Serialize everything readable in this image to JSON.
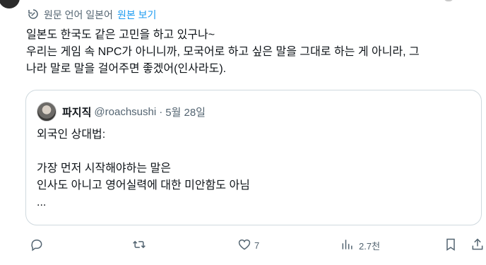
{
  "translation": {
    "note": "원문 언어 일본어",
    "show_original": "원본 보기"
  },
  "tweet": {
    "lines": [
      "일본도 한국도 같은 고민을 하고 있구나~",
      "우리는 게임 속 NPC가 아니니까, 모국어로 하고 싶은 말을 그대로 하는 게 아니라, 그",
      "나라 말로 말을 걸어주면 좋겠어(인사라도)."
    ]
  },
  "quote": {
    "name": "파지직",
    "handle": "@roachsushi",
    "separator": "·",
    "date": "5월 28일",
    "lines": [
      "외국인 상대법:",
      "",
      "가장 먼저 시작해야하는 말은",
      "인사도 아니고 영어실력에 대한 미안함도 아님",
      "..."
    ]
  },
  "actions": {
    "reply_count": "",
    "retweet_count": "",
    "like_count": "7",
    "views_count": "2.7천"
  },
  "icons": {
    "translate": "translate-icon",
    "reply": "reply-icon",
    "retweet": "retweet-icon",
    "like": "heart-icon",
    "views": "views-icon",
    "bookmark": "bookmark-icon",
    "share": "share-icon"
  },
  "colors": {
    "link": "#1d9bf0",
    "muted": "#536471",
    "text": "#0f1419",
    "border": "#cfd9de"
  }
}
